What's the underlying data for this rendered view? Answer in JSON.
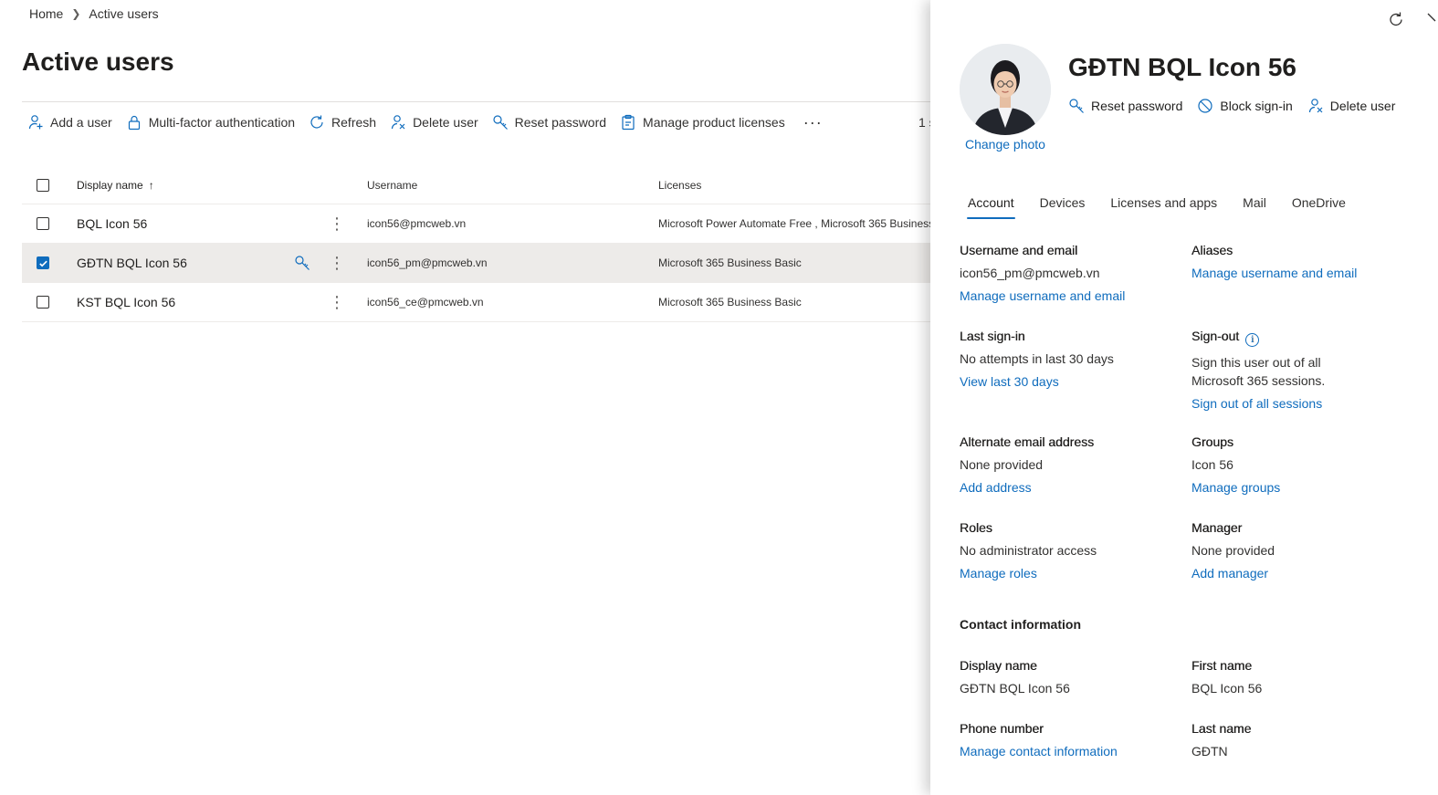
{
  "breadcrumb": {
    "home": "Home",
    "current": "Active users"
  },
  "page": {
    "title": "Active users",
    "count_text": "1 s"
  },
  "commandbar": {
    "add_user": "Add a user",
    "mfa": "Multi-factor authentication",
    "refresh": "Refresh",
    "delete_user": "Delete user",
    "reset_password": "Reset password",
    "manage_licenses": "Manage product licenses",
    "more": "···"
  },
  "grid": {
    "headers": {
      "display_name": "Display name",
      "username": "Username",
      "licenses": "Licenses",
      "sort_icon": "↑"
    },
    "rows": [
      {
        "name": "BQL Icon 56",
        "username": "icon56@pmcweb.vn",
        "licenses": "Microsoft Power Automate Free , Microsoft 365 Business",
        "selected": false
      },
      {
        "name": "GĐTN BQL Icon 56",
        "username": "icon56_pm@pmcweb.vn",
        "licenses": "Microsoft 365 Business Basic",
        "selected": true
      },
      {
        "name": "KST BQL Icon 56",
        "username": "icon56_ce@pmcweb.vn",
        "licenses": "Microsoft 365 Business Basic",
        "selected": false
      }
    ]
  },
  "panel": {
    "title": "GĐTN BQL Icon 56",
    "change_photo": "Change photo",
    "actions": {
      "reset_password": "Reset password",
      "block_signin": "Block sign-in",
      "delete_user": "Delete user"
    },
    "tabs": [
      "Account",
      "Devices",
      "Licenses and apps",
      "Mail",
      "OneDrive"
    ],
    "account": {
      "username_label": "Username and email",
      "username_value": "icon56_pm@pmcweb.vn",
      "username_link": "Manage username and email",
      "aliases_label": "Aliases",
      "aliases_link": "Manage username and email",
      "last_signin_label": "Last sign-in",
      "last_signin_value": "No attempts in last 30 days",
      "last_signin_link": "View last 30 days",
      "signout_label": "Sign-out",
      "signout_info_icon": "i",
      "signout_text_1": "Sign this user out of all",
      "signout_text_2": "Microsoft 365 sessions.",
      "signout_link": "Sign out of all sessions",
      "alt_email_label": "Alternate email address",
      "alt_email_value": "None provided",
      "alt_email_link": "Add address",
      "groups_label": "Groups",
      "groups_value": "Icon 56",
      "groups_link": "Manage groups",
      "roles_label": "Roles",
      "roles_value": "No administrator access",
      "roles_link": "Manage roles",
      "manager_label": "Manager",
      "manager_value": "None provided",
      "manager_link": "Add manager",
      "contact_title": "Contact information",
      "display_name_label": "Display name",
      "display_name_value": "GĐTN BQL Icon 56",
      "first_name_label": "First name",
      "first_name_value": "BQL Icon 56",
      "phone_label": "Phone number",
      "phone_link": "Manage contact information",
      "last_name_label": "Last name",
      "last_name_value": "GĐTN"
    }
  },
  "colors": {
    "accent": "#0f6cbd",
    "selected_row": "#edebe9",
    "text": "#323130"
  },
  "icons": [
    "add-user-icon",
    "lock-icon",
    "refresh-icon",
    "delete-user-icon",
    "key-icon",
    "license-icon",
    "block-icon",
    "close-icon",
    "info-icon"
  ]
}
